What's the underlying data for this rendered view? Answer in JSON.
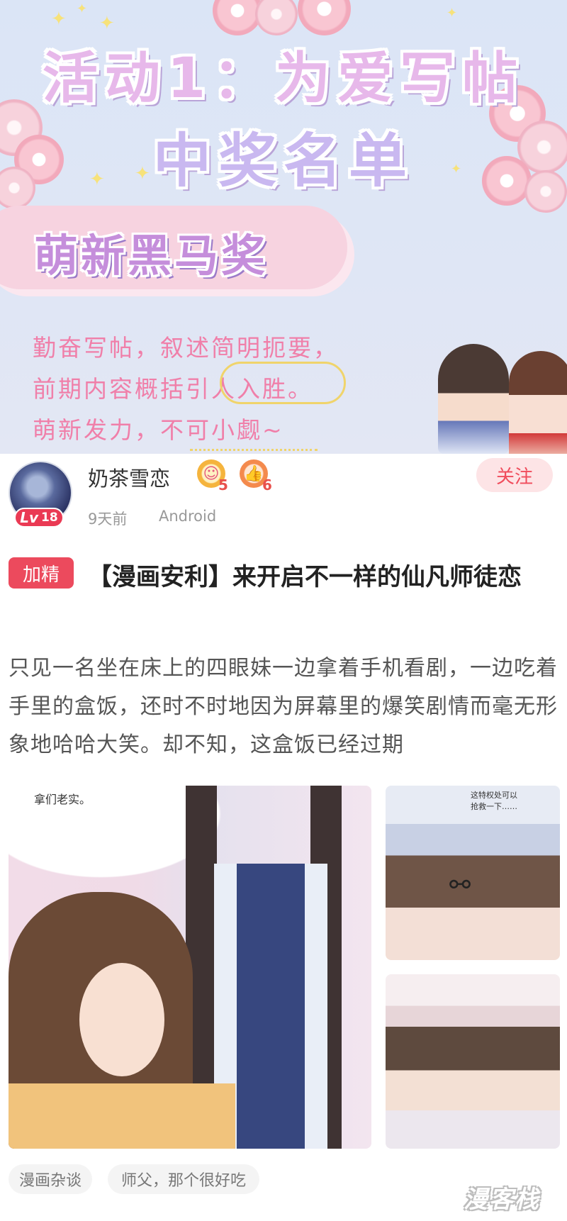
{
  "banner": {
    "title_line1": "活动1：为爱写帖",
    "title_line2": "中奖名单",
    "award": "萌新黑马奖",
    "desc_line1": "勤奋写帖，叙述简明扼要，",
    "desc_line2": "前期内容概括引人入胜。",
    "desc_line3": "萌新发力，不可小觑~"
  },
  "post": {
    "username": "奶茶雪恋",
    "level_prefix": "Lv",
    "level": "18",
    "fans_badge_count": "5",
    "likes_badge_count": "6",
    "time": "9天前",
    "device": "Android",
    "follow_label": "关注",
    "tag_label": "加精",
    "title": "【漫画安利】来开启不一样的仙凡师徒恋",
    "body": "只见一名坐在床上的四眼妹一边拿着手机看剧，一边吃着手里的盒饭，还时不时地因为屏幕里的爆笑剧情而毫无形象地哈哈大笑。却不知，这盒饭已经过期"
  },
  "images": {
    "main_caption": "拿们老实。",
    "small1_caption_line1": "这特权处可以",
    "small1_caption_line2": "抢救一下……"
  },
  "tags": [
    "漫画杂谈",
    "师父，那个很好吃"
  ],
  "watermark": "漫客栈",
  "colors": {
    "accent_red": "#ec4a5d",
    "follow_bg": "#fde4e6",
    "banner_bg": "#dbe5f6",
    "award_pill": "#f7d3e0",
    "desc_pink": "#f07fa9"
  }
}
